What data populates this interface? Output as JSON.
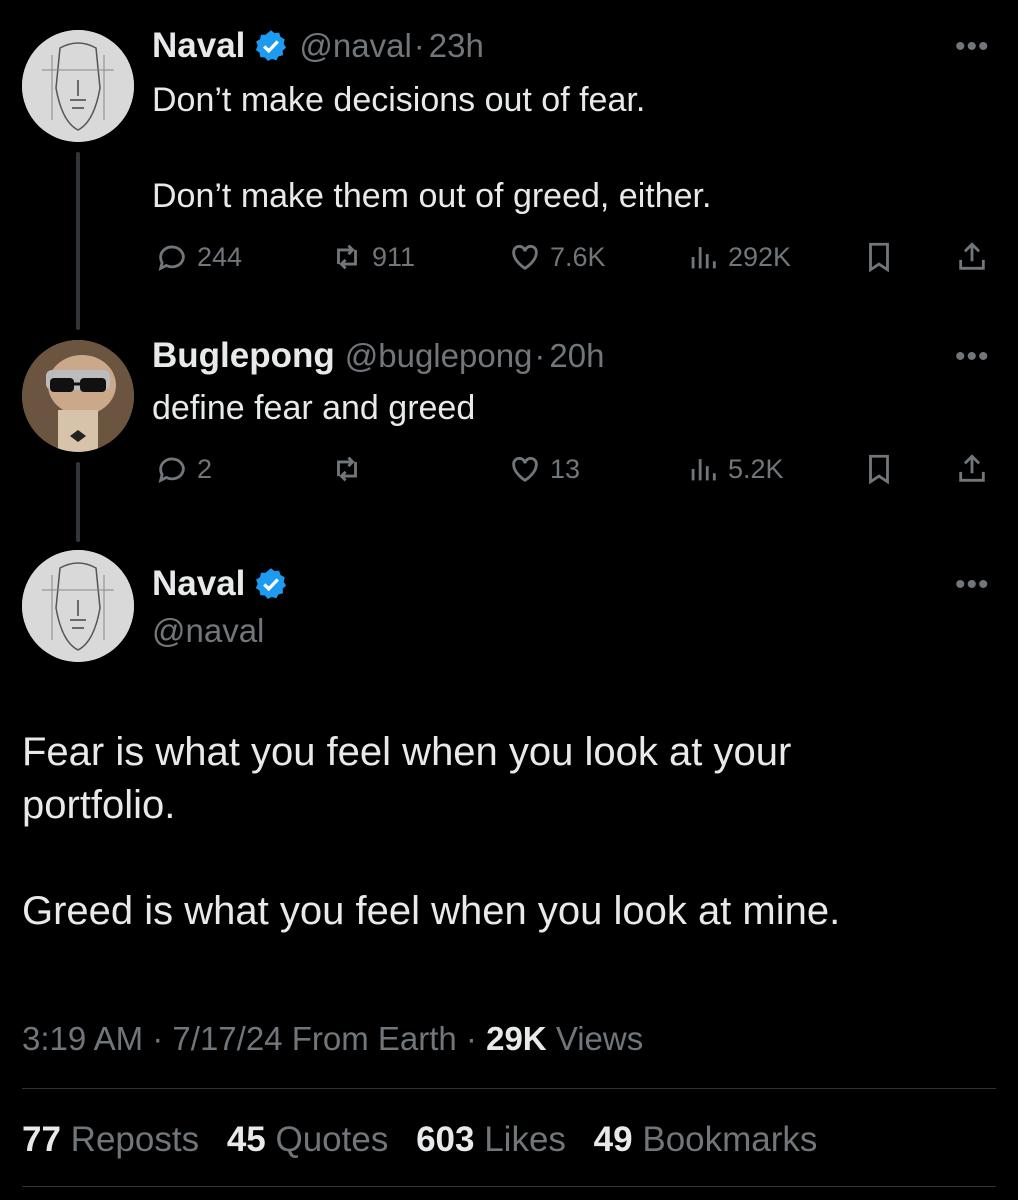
{
  "tweet1": {
    "name": "Naval",
    "handle": "@naval",
    "time": "23h",
    "text": "Don’t make decisions out of fear.\n\nDon’t make them out of greed, either.",
    "replies": "244",
    "reposts": "911",
    "likes": "7.6K",
    "views": "292K"
  },
  "tweet2": {
    "name": "Buglepong",
    "handle": "@buglepong",
    "time": "20h",
    "text": "define fear and greed",
    "replies": "2",
    "reposts": "",
    "likes": "13",
    "views": "5.2K"
  },
  "main": {
    "name": "Naval",
    "handle": "@naval",
    "text": "Fear is what you feel when you look at your\nportfolio.\n\nGreed is what you feel when you look at mine.",
    "time": "3:19 AM",
    "date": "7/17/24",
    "source": "From Earth",
    "views_count": "29K",
    "views_label": "Views",
    "reposts_count": "77",
    "reposts_label": "Reposts",
    "quotes_count": "45",
    "quotes_label": "Quotes",
    "likes_count": "603",
    "likes_label": "Likes",
    "bookmarks_count": "49",
    "bookmarks_label": "Bookmarks"
  },
  "separator": "·",
  "more_label": "•••",
  "colors": {
    "background": "#000000",
    "text": "#e7e9ea",
    "muted": "#71767b",
    "verified": "#1d9bf0",
    "divider": "#2f3336"
  },
  "icons": [
    "verified-badge-icon",
    "reply-icon",
    "repost-icon",
    "like-icon",
    "views-icon",
    "bookmark-icon",
    "share-icon",
    "more-icon"
  ]
}
